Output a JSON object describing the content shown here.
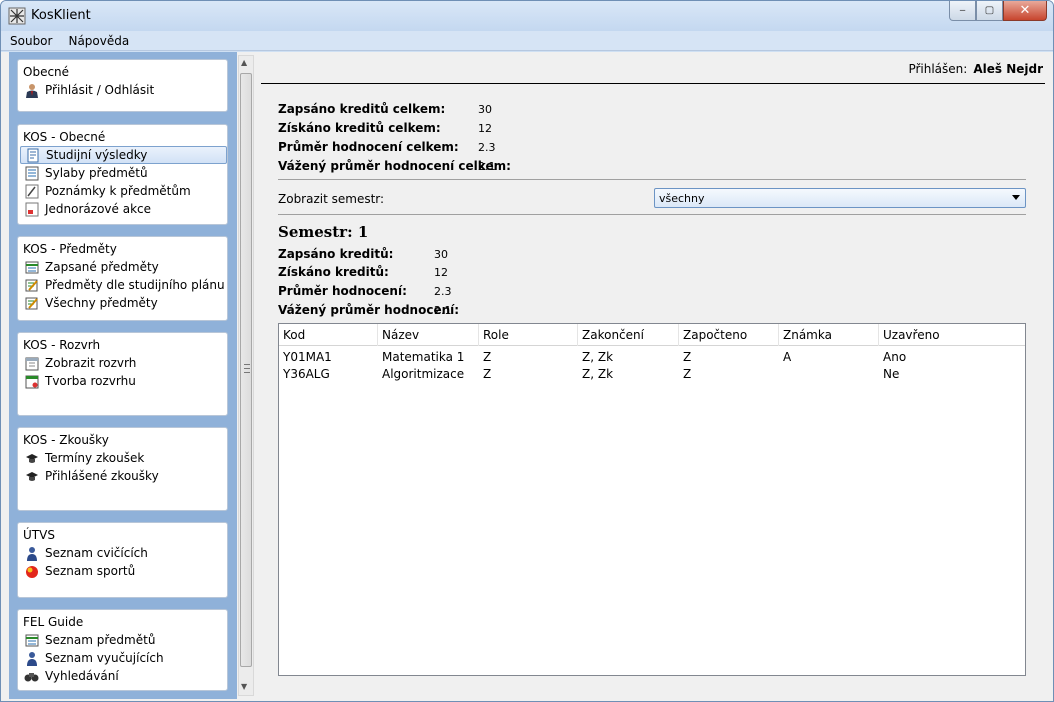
{
  "window": {
    "title": "KosKlient",
    "minimize": "‒",
    "maximize": "▢",
    "close": "✕"
  },
  "menu": [
    {
      "label": "Soubor"
    },
    {
      "label": "Nápověda"
    }
  ],
  "sidebar": {
    "groups": [
      {
        "title": "Obecné",
        "items": [
          {
            "label": "Přihlásit / Odhlásit",
            "icon": "user-icon"
          }
        ]
      },
      {
        "title": "KOS - Obecné",
        "items": [
          {
            "label": "Studijní výsledky",
            "icon": "results-icon",
            "selected": true
          },
          {
            "label": "Sylaby předmětů",
            "icon": "list-icon"
          },
          {
            "label": "Poznámky k předmětům",
            "icon": "note-icon"
          },
          {
            "label": "Jednorázové akce",
            "icon": "event-icon"
          }
        ]
      },
      {
        "title": "KOS - Předměty",
        "items": [
          {
            "label": "Zapsané předměty",
            "icon": "table-icon"
          },
          {
            "label": "Předměty dle studijního plánu",
            "icon": "edit-icon"
          },
          {
            "label": "Všechny předměty",
            "icon": "edit-icon"
          }
        ]
      },
      {
        "title": "KOS - Rozvrh",
        "items": [
          {
            "label": "Zobrazit rozvrh",
            "icon": "calendar-icon"
          },
          {
            "label": "Tvorba rozvrhu",
            "icon": "calendar-edit-icon"
          }
        ]
      },
      {
        "title": "KOS - Zkoušky",
        "items": [
          {
            "label": "Termíny zkoušek",
            "icon": "graduation-cap-icon"
          },
          {
            "label": "Přihlášené zkoušky",
            "icon": "graduation-cap-icon"
          }
        ]
      },
      {
        "title": "ÚTVS",
        "items": [
          {
            "label": "Seznam cvičících",
            "icon": "person-icon"
          },
          {
            "label": "Seznam sportů",
            "icon": "ball-icon"
          }
        ]
      },
      {
        "title": "FEL Guide",
        "items": [
          {
            "label": "Seznam předmětů",
            "icon": "table-icon"
          },
          {
            "label": "Seznam vyučujících",
            "icon": "person-icon"
          },
          {
            "label": "Vyhledávání",
            "icon": "binoculars-icon"
          }
        ]
      }
    ]
  },
  "main": {
    "login_label": "Přihlášen:",
    "login_user": "Aleš Nejdr",
    "summary": [
      {
        "label": "Zapsáno kreditů celkem:",
        "value": "30"
      },
      {
        "label": "Získáno kreditů celkem:",
        "value": "12"
      },
      {
        "label": "Průměr hodnocení celkem:",
        "value": "2.3"
      },
      {
        "label": "Vážený průměr hodnocení celkem:",
        "value": "2.1"
      }
    ],
    "semester_filter_label": "Zobrazit semestr:",
    "semester_filter_value": "všechny",
    "semester_title": "Semestr: 1",
    "semester_summary": [
      {
        "label": "Zapsáno kreditů:",
        "value": "30"
      },
      {
        "label": "Získáno kreditů:",
        "value": "12"
      },
      {
        "label": "Průměr hodnocení:",
        "value": "2.3"
      },
      {
        "label": "Vážený průměr hodnocení:",
        "value": "2.1"
      }
    ],
    "table": {
      "columns": [
        "Kod",
        "Název",
        "Role",
        "Zakončení",
        "Započteno",
        "Známka",
        "Uzavřeno"
      ],
      "rows": [
        [
          "Y01MA1",
          "Matematika 1",
          "Z",
          "Z, Zk",
          "Z",
          "A",
          "Ano"
        ],
        [
          "Y36ALG",
          "Algoritmizace",
          "Z",
          "Z, Zk",
          "Z",
          "",
          "Ne"
        ]
      ]
    }
  }
}
